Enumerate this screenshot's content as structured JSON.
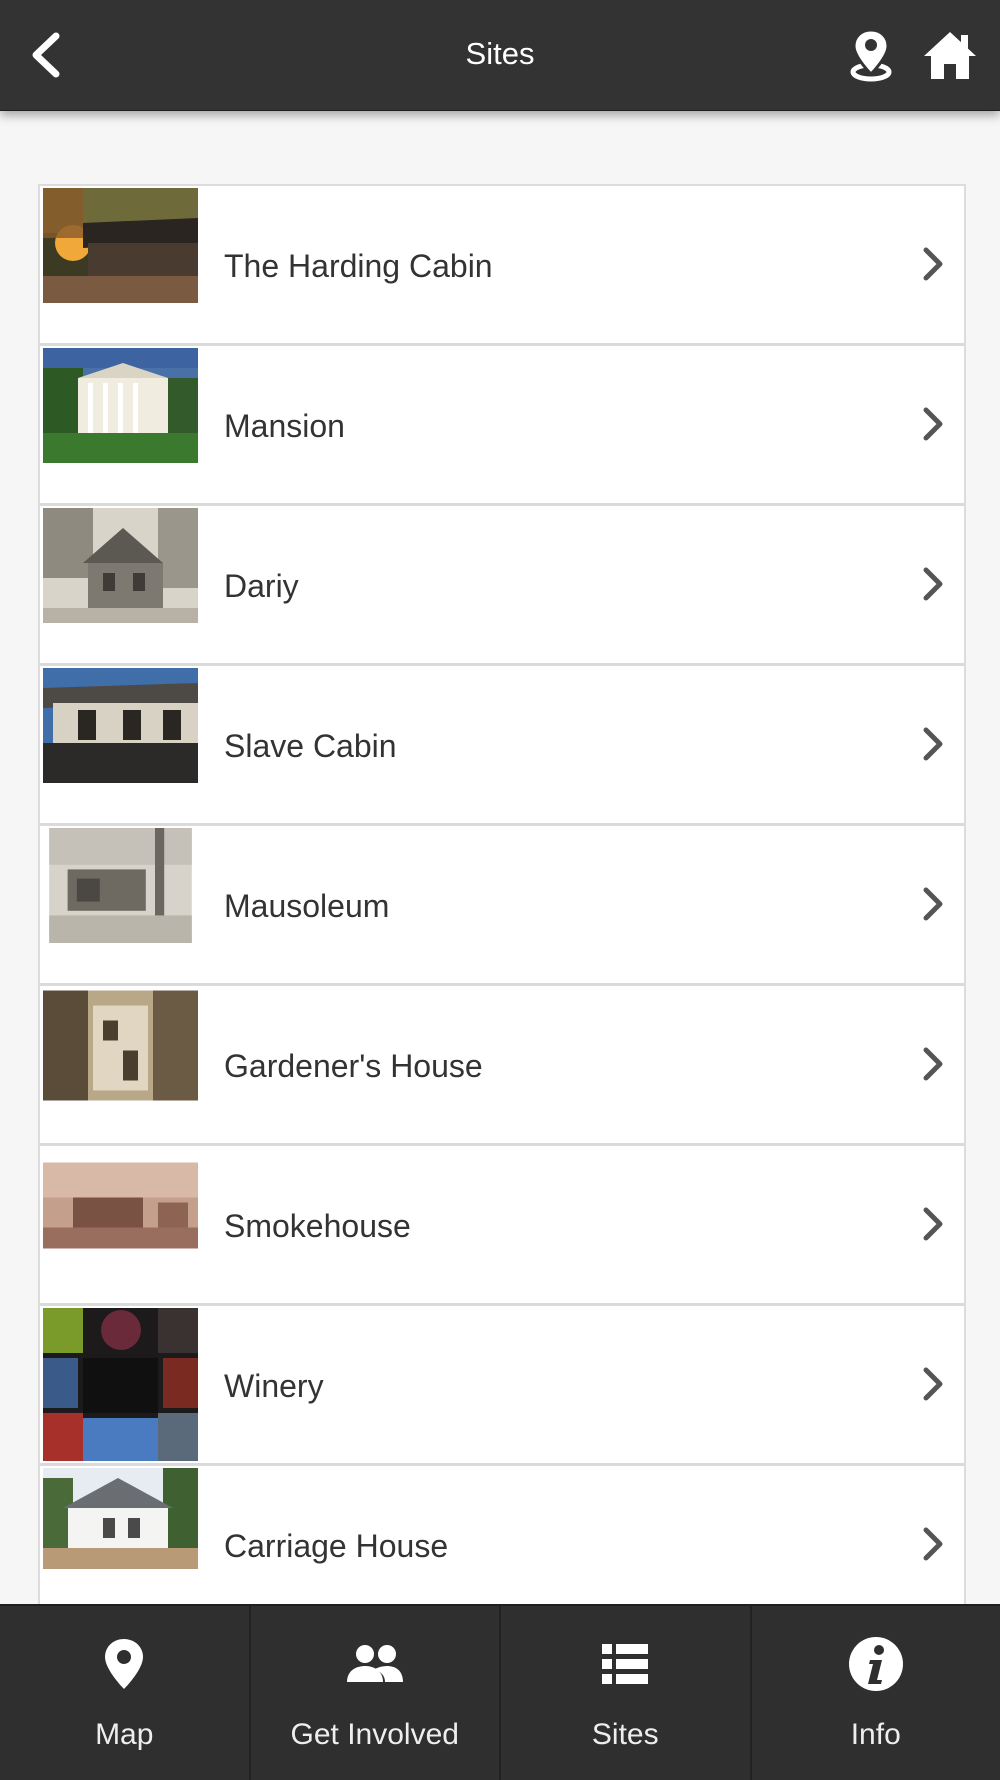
{
  "header": {
    "title": "Sites",
    "back_icon": "chevron-left-icon",
    "location_icon": "map-pin-icon",
    "home_icon": "home-icon"
  },
  "sites": [
    {
      "label": "The Harding Cabin"
    },
    {
      "label": "Mansion"
    },
    {
      "label": "Dariy"
    },
    {
      "label": "Slave Cabin"
    },
    {
      "label": "Mausoleum"
    },
    {
      "label": "Gardener's House"
    },
    {
      "label": "Smokehouse"
    },
    {
      "label": "Winery"
    },
    {
      "label": "Carriage House"
    }
  ],
  "footer": {
    "tabs": [
      {
        "label": "Map",
        "icon": "map-pin-icon"
      },
      {
        "label": "Get Involved",
        "icon": "people-icon"
      },
      {
        "label": "Sites",
        "icon": "list-icon"
      },
      {
        "label": "Info",
        "icon": "info-icon"
      }
    ]
  },
  "colors": {
    "header_bg": "#333333",
    "footer_bg": "#2f2f2f",
    "page_bg": "#f6f6f6",
    "text": "#333333"
  }
}
